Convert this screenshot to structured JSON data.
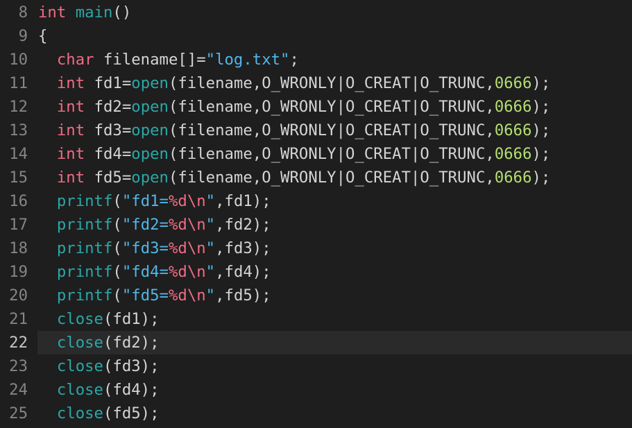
{
  "editor": {
    "current_line": "22",
    "lines": [
      {
        "num": "8",
        "tokens": [
          {
            "t": "int",
            "c": "kw"
          },
          {
            "t": " ",
            "c": "punc"
          },
          {
            "t": "main",
            "c": "fn"
          },
          {
            "t": "()",
            "c": "punc"
          }
        ]
      },
      {
        "num": "9",
        "tokens": [
          {
            "t": "{",
            "c": "punc"
          }
        ]
      },
      {
        "num": "10",
        "tokens": [
          {
            "t": "  ",
            "c": "punc"
          },
          {
            "t": "char",
            "c": "kw"
          },
          {
            "t": " filename[]=",
            "c": "id"
          },
          {
            "t": "\"log.txt\"",
            "c": "str"
          },
          {
            "t": ";",
            "c": "punc"
          }
        ]
      },
      {
        "num": "11",
        "tokens": [
          {
            "t": "  ",
            "c": "punc"
          },
          {
            "t": "int",
            "c": "kw"
          },
          {
            "t": " fd1=",
            "c": "id"
          },
          {
            "t": "open",
            "c": "fn"
          },
          {
            "t": "(filename,O_WRONLY|O_CREAT|O_TRUNC,",
            "c": "id"
          },
          {
            "t": "0666",
            "c": "num"
          },
          {
            "t": ");",
            "c": "punc"
          }
        ]
      },
      {
        "num": "12",
        "tokens": [
          {
            "t": "  ",
            "c": "punc"
          },
          {
            "t": "int",
            "c": "kw"
          },
          {
            "t": " fd2=",
            "c": "id"
          },
          {
            "t": "open",
            "c": "fn"
          },
          {
            "t": "(filename,O_WRONLY|O_CREAT|O_TRUNC,",
            "c": "id"
          },
          {
            "t": "0666",
            "c": "num"
          },
          {
            "t": ");",
            "c": "punc"
          }
        ]
      },
      {
        "num": "13",
        "tokens": [
          {
            "t": "  ",
            "c": "punc"
          },
          {
            "t": "int",
            "c": "kw"
          },
          {
            "t": " fd3=",
            "c": "id"
          },
          {
            "t": "open",
            "c": "fn"
          },
          {
            "t": "(filename,O_WRONLY|O_CREAT|O_TRUNC,",
            "c": "id"
          },
          {
            "t": "0666",
            "c": "num"
          },
          {
            "t": ");",
            "c": "punc"
          }
        ]
      },
      {
        "num": "14",
        "tokens": [
          {
            "t": "  ",
            "c": "punc"
          },
          {
            "t": "int",
            "c": "kw"
          },
          {
            "t": " fd4=",
            "c": "id"
          },
          {
            "t": "open",
            "c": "fn"
          },
          {
            "t": "(filename,O_WRONLY|O_CREAT|O_TRUNC,",
            "c": "id"
          },
          {
            "t": "0666",
            "c": "num"
          },
          {
            "t": ");",
            "c": "punc"
          }
        ]
      },
      {
        "num": "15",
        "tokens": [
          {
            "t": "  ",
            "c": "punc"
          },
          {
            "t": "int",
            "c": "kw"
          },
          {
            "t": " fd5=",
            "c": "id"
          },
          {
            "t": "open",
            "c": "fn"
          },
          {
            "t": "(filename,O_WRONLY|O_CREAT|O_TRUNC,",
            "c": "id"
          },
          {
            "t": "0666",
            "c": "num"
          },
          {
            "t": ");",
            "c": "punc"
          }
        ]
      },
      {
        "num": "16",
        "tokens": [
          {
            "t": "  ",
            "c": "punc"
          },
          {
            "t": "printf",
            "c": "fn"
          },
          {
            "t": "(",
            "c": "punc"
          },
          {
            "t": "\"fd1=",
            "c": "str"
          },
          {
            "t": "%d\\n",
            "c": "esc"
          },
          {
            "t": "\"",
            "c": "str"
          },
          {
            "t": ",fd1);",
            "c": "id"
          }
        ]
      },
      {
        "num": "17",
        "tokens": [
          {
            "t": "  ",
            "c": "punc"
          },
          {
            "t": "printf",
            "c": "fn"
          },
          {
            "t": "(",
            "c": "punc"
          },
          {
            "t": "\"fd2=",
            "c": "str"
          },
          {
            "t": "%d\\n",
            "c": "esc"
          },
          {
            "t": "\"",
            "c": "str"
          },
          {
            "t": ",fd2);",
            "c": "id"
          }
        ]
      },
      {
        "num": "18",
        "tokens": [
          {
            "t": "  ",
            "c": "punc"
          },
          {
            "t": "printf",
            "c": "fn"
          },
          {
            "t": "(",
            "c": "punc"
          },
          {
            "t": "\"fd3=",
            "c": "str"
          },
          {
            "t": "%d\\n",
            "c": "esc"
          },
          {
            "t": "\"",
            "c": "str"
          },
          {
            "t": ",fd3);",
            "c": "id"
          }
        ]
      },
      {
        "num": "19",
        "tokens": [
          {
            "t": "  ",
            "c": "punc"
          },
          {
            "t": "printf",
            "c": "fn"
          },
          {
            "t": "(",
            "c": "punc"
          },
          {
            "t": "\"fd4=",
            "c": "str"
          },
          {
            "t": "%d\\n",
            "c": "esc"
          },
          {
            "t": "\"",
            "c": "str"
          },
          {
            "t": ",fd4);",
            "c": "id"
          }
        ]
      },
      {
        "num": "20",
        "tokens": [
          {
            "t": "  ",
            "c": "punc"
          },
          {
            "t": "printf",
            "c": "fn"
          },
          {
            "t": "(",
            "c": "punc"
          },
          {
            "t": "\"fd5=",
            "c": "str"
          },
          {
            "t": "%d\\n",
            "c": "esc"
          },
          {
            "t": "\"",
            "c": "str"
          },
          {
            "t": ",fd5);",
            "c": "id"
          }
        ]
      },
      {
        "num": "21",
        "tokens": [
          {
            "t": "  ",
            "c": "punc"
          },
          {
            "t": "close",
            "c": "fn"
          },
          {
            "t": "(fd1);",
            "c": "id"
          }
        ]
      },
      {
        "num": "22",
        "tokens": [
          {
            "t": "  ",
            "c": "punc"
          },
          {
            "t": "close",
            "c": "fn"
          },
          {
            "t": "(fd2);",
            "c": "id"
          }
        ]
      },
      {
        "num": "23",
        "tokens": [
          {
            "t": "  ",
            "c": "punc"
          },
          {
            "t": "close",
            "c": "fn"
          },
          {
            "t": "(fd3);",
            "c": "id"
          }
        ]
      },
      {
        "num": "24",
        "tokens": [
          {
            "t": "  ",
            "c": "punc"
          },
          {
            "t": "close",
            "c": "fn"
          },
          {
            "t": "(fd4);",
            "c": "id"
          }
        ]
      },
      {
        "num": "25",
        "tokens": [
          {
            "t": "  ",
            "c": "punc"
          },
          {
            "t": "close",
            "c": "fn"
          },
          {
            "t": "(fd5);",
            "c": "id"
          }
        ]
      }
    ]
  }
}
